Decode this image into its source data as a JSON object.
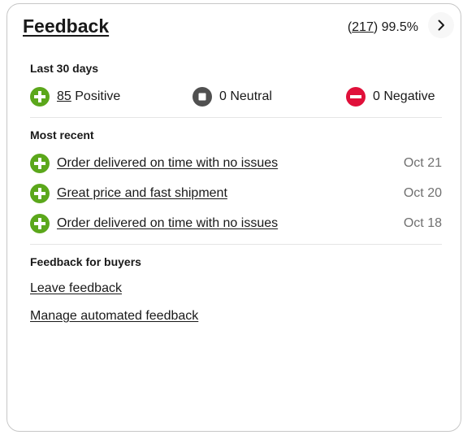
{
  "header": {
    "title": "Feedback",
    "count_open": "(",
    "count": "217",
    "count_close": ")",
    "percent": "99.5%"
  },
  "last30": {
    "label": "Last 30 days",
    "positive_count": "85",
    "positive_label": "Positive",
    "neutral": "0 Neutral",
    "negative": "0 Negative"
  },
  "recent": {
    "label": "Most recent",
    "items": [
      {
        "comment": "Order delivered on time with no issues",
        "date": "Oct 21",
        "rating": "positive"
      },
      {
        "comment": "Great price and fast shipment",
        "date": "Oct 20",
        "rating": "positive"
      },
      {
        "comment": "Order delivered on time with no issues",
        "date": "Oct 18",
        "rating": "positive"
      }
    ]
  },
  "buyers": {
    "label": "Feedback for buyers",
    "leave": "Leave feedback",
    "manage": "Manage automated feedback"
  },
  "icons": {
    "positive": "plus-circle-icon",
    "neutral": "square-circle-icon",
    "negative": "minus-circle-icon",
    "chevron": "chevron-right-icon"
  },
  "colors": {
    "positive": "#5ba71b",
    "neutral": "#505050",
    "negative": "#e0103a"
  }
}
